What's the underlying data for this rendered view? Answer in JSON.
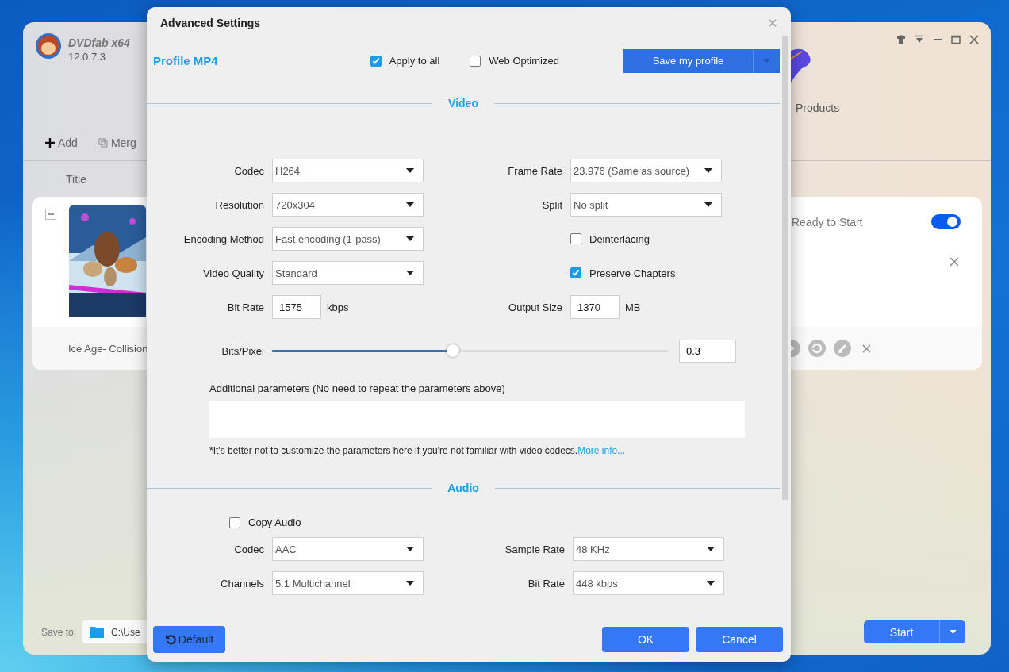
{
  "app_window": {
    "brand": "DVDfab x64",
    "version": "12.0.7.3",
    "toolbar": [
      "Add",
      "Merg"
    ],
    "column_title": "Title",
    "nav_label": "Products",
    "task": {
      "title": "Ice Age- Collision",
      "status": "Ready to Start",
      "enabled": true
    },
    "save_to": {
      "label": "Save to:",
      "path": "C:\\Use"
    },
    "start_button": "Start"
  },
  "dialog": {
    "title": "Advanced Settings",
    "profile_label": "Profile",
    "profile_name": "MP4",
    "options": [
      {
        "label": "Apply to all",
        "checked": true
      },
      {
        "label": "Web Optimized",
        "checked": false
      }
    ],
    "save_button": "Save my profile",
    "video": {
      "heading": "Video",
      "fields": [
        {
          "kind": "select",
          "label": "Codec",
          "value": "H264"
        },
        {
          "kind": "select",
          "label": "Frame Rate",
          "value": "23.976 (Same as source)"
        },
        {
          "kind": "select",
          "label": "Resolution",
          "value": "720x304"
        },
        {
          "kind": "select",
          "label": "Split",
          "value": "No split"
        },
        {
          "kind": "select",
          "label": "Encoding Method",
          "value": "Fast encoding (1-pass)"
        },
        {
          "kind": "checkbox",
          "label": "Deinterlacing",
          "checked": false
        },
        {
          "kind": "select",
          "label": "Video Quality",
          "value": "Standard"
        },
        {
          "kind": "checkbox",
          "label": "Preserve Chapters",
          "checked": true
        },
        {
          "kind": "number",
          "label": "Bit Rate",
          "value": "1575",
          "unit": "kbps"
        },
        {
          "kind": "number",
          "label": "Output Size",
          "value": "1370",
          "unit": "MB"
        }
      ],
      "bits_per_pixel": {
        "label": "Bits/Pixel",
        "level": 0.456,
        "value": "0.3"
      },
      "additional": {
        "label": "Additional parameters (No need to repeat the parameters above)",
        "note": "*It's better not to customize the parameters here if you're not familiar with video codecs.",
        "link": "More info..."
      }
    },
    "audio": {
      "heading": "Audio",
      "copy_audio": {
        "label": "Copy Audio",
        "checked": false
      },
      "fields": [
        {
          "kind": "select",
          "label": "Codec",
          "value": "AAC"
        },
        {
          "kind": "select",
          "label": "Sample Rate",
          "value": "48 KHz"
        },
        {
          "kind": "select",
          "label": "Channels",
          "value": "5.1 Multichannel"
        },
        {
          "kind": "select",
          "label": "Bit Rate",
          "value": "448 kbps"
        }
      ]
    },
    "buttons": {
      "default": "Default",
      "ok": "OK",
      "cancel": "Cancel"
    }
  }
}
